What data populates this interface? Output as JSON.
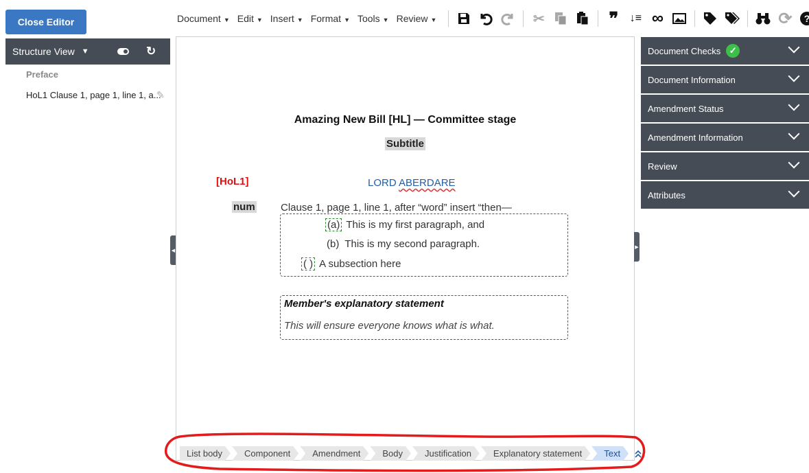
{
  "close_button": "Close Editor",
  "menu": [
    {
      "label": "Document"
    },
    {
      "label": "Edit"
    },
    {
      "label": "Insert"
    },
    {
      "label": "Format"
    },
    {
      "label": "Tools"
    },
    {
      "label": "Review"
    }
  ],
  "toolbar_icons": [
    {
      "name": "save-icon",
      "glyph": "💾"
    },
    {
      "name": "undo-icon",
      "glyph": "↶"
    },
    {
      "name": "redo-icon",
      "glyph": "↷"
    },
    {
      "name": "cut-icon",
      "glyph": "✂"
    },
    {
      "name": "copy-icon",
      "glyph": "⧉"
    },
    {
      "name": "paste-icon",
      "glyph": "📋"
    },
    {
      "name": "quote-icon",
      "glyph": "❞"
    },
    {
      "name": "sort-icon",
      "glyph": "⇅"
    },
    {
      "name": "link-icon",
      "glyph": "∞"
    },
    {
      "name": "image-icon",
      "glyph": "🖼"
    },
    {
      "name": "tag-icon",
      "glyph": "🏷"
    },
    {
      "name": "tags-icon",
      "glyph": "🏷"
    },
    {
      "name": "find-icon",
      "glyph": "🔭"
    },
    {
      "name": "refresh-icon",
      "glyph": "⟳"
    },
    {
      "name": "help-icon",
      "glyph": "?"
    }
  ],
  "structure": {
    "title": "Structure View",
    "preface": "Preface",
    "item": "HoL1 Clause 1, page 1, line 1, a..."
  },
  "document": {
    "title": "Amazing New Bill [HL] — Committee stage",
    "subtitle": "Subtitle",
    "tag": "[HoL1]",
    "lord_first": "LORD",
    "lord_second": "ABERDARE",
    "num_label": "num",
    "clause": "Clause 1, page 1, line 1, after “word” insert “then—",
    "paragraphs": [
      {
        "mark": "(a)",
        "text": "This is my first paragraph, and"
      },
      {
        "mark": "(b)",
        "text": "This is my second paragraph."
      },
      {
        "mark": "(  )",
        "text": "A subsection here"
      }
    ],
    "statement_heading": "Member's explanatory statement",
    "statement_body": "This will ensure everyone knows what is what."
  },
  "right_panels": [
    {
      "label": "Document Checks",
      "checked": true
    },
    {
      "label": "Document Information"
    },
    {
      "label": "Amendment Status"
    },
    {
      "label": "Amendment Information"
    },
    {
      "label": "Review"
    },
    {
      "label": "Attributes"
    }
  ],
  "breadcrumb": [
    "List body",
    "Component",
    "Amendment",
    "Body",
    "Justification",
    "Explanatory statement",
    "Text"
  ],
  "colors": {
    "accent": "#3a78c3",
    "panel": "#454c55",
    "tag_red": "#e01010",
    "lord_blue": "#1f5fa8",
    "annotation_red": "#e31b1b"
  }
}
